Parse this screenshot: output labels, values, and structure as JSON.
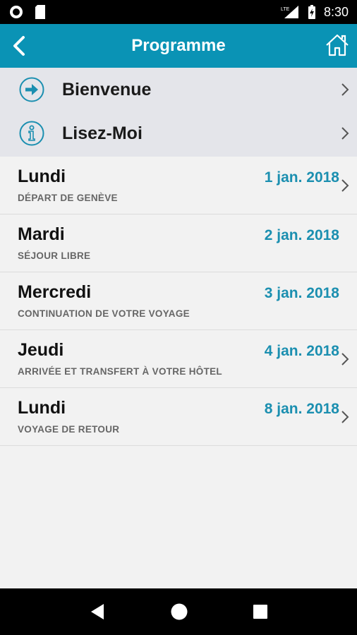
{
  "status": {
    "time": "8:30",
    "network": "LTE"
  },
  "app_bar": {
    "title": "Programme"
  },
  "menu": [
    {
      "label": "Bienvenue",
      "icon": "arrow-right-circle-icon"
    },
    {
      "label": "Lisez-Moi",
      "icon": "info-circle-icon"
    }
  ],
  "days": [
    {
      "name": "Lundi",
      "subtitle": "DÉPART DE GENÈVE",
      "date": "1 jan. 2018",
      "has_chevron": true
    },
    {
      "name": "Mardi",
      "subtitle": "SÉJOUR LIBRE",
      "date": "2 jan. 2018",
      "has_chevron": false
    },
    {
      "name": "Mercredi",
      "subtitle": "CONTINUATION DE VOTRE VOYAGE",
      "date": "3 jan. 2018",
      "has_chevron": false
    },
    {
      "name": "Jeudi",
      "subtitle": "ARRIVÉE ET TRANSFERT À VOTRE HÔTEL",
      "date": "4 jan. 2018",
      "has_chevron": true
    },
    {
      "name": "Lundi",
      "subtitle": "VOYAGE DE RETOUR",
      "date": "8 jan. 2018",
      "has_chevron": true
    }
  ],
  "colors": {
    "accent": "#0a93b5",
    "date": "#1b8fb0",
    "menu_bg": "#e4e5ea"
  }
}
